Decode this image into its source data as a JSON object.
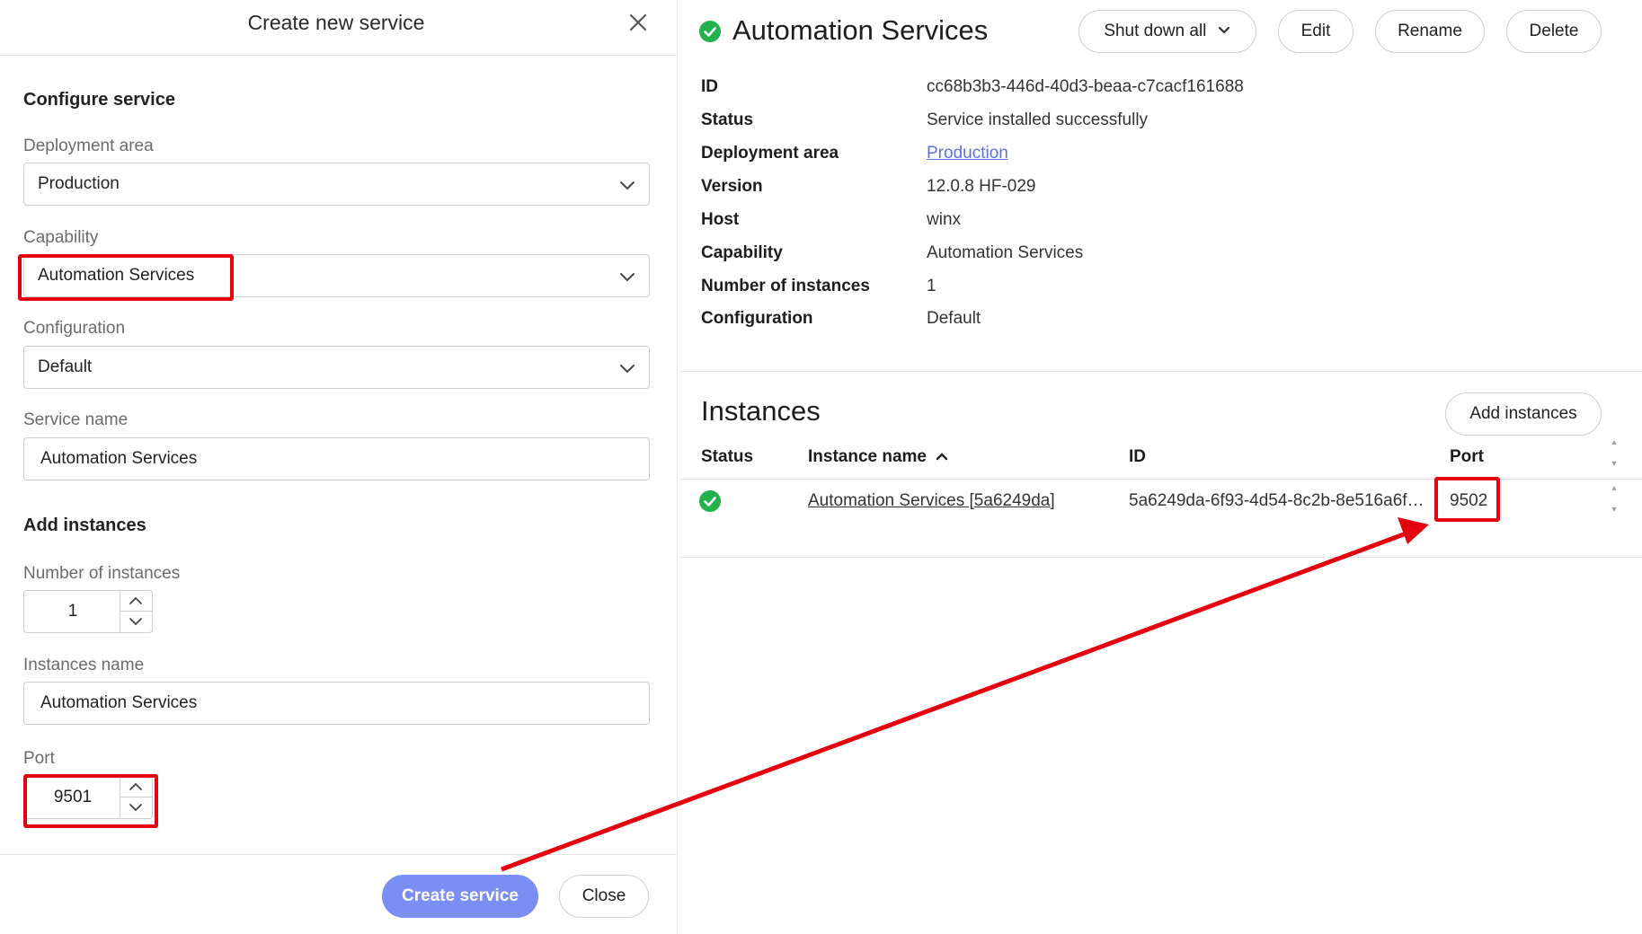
{
  "dialog": {
    "title": "Create new service",
    "configure_title": "Configure service",
    "deployment_area": {
      "label": "Deployment area",
      "value": "Production"
    },
    "capability": {
      "label": "Capability",
      "value": "Automation Services"
    },
    "configuration": {
      "label": "Configuration",
      "value": "Default"
    },
    "service_name": {
      "label": "Service name",
      "value": "Automation Services"
    },
    "add_instances_title": "Add instances",
    "number_of_instances": {
      "label": "Number of instances",
      "value": "1"
    },
    "instances_name": {
      "label": "Instances name",
      "value": "Automation Services"
    },
    "port": {
      "label": "Port",
      "value": "9501"
    },
    "create_label": "Create service",
    "close_label": "Close"
  },
  "service": {
    "title": "Automation Services",
    "actions": {
      "shutdown": "Shut down all",
      "edit": "Edit",
      "rename": "Rename",
      "delete": "Delete"
    },
    "details": [
      {
        "key": "ID",
        "value": "cc68b3b3-446d-40d3-beaa-c7cacf161688",
        "link": false
      },
      {
        "key": "Status",
        "value": "Service installed successfully",
        "link": false
      },
      {
        "key": "Deployment area",
        "value": "Production",
        "link": true
      },
      {
        "key": "Version",
        "value": "12.0.8 HF-029",
        "link": false
      },
      {
        "key": "Host",
        "value": "winx",
        "link": false
      },
      {
        "key": "Capability",
        "value": "Automation Services",
        "link": false
      },
      {
        "key": "Number of instances",
        "value": "1",
        "link": false
      },
      {
        "key": "Configuration",
        "value": "Default",
        "link": false
      }
    ]
  },
  "instances": {
    "title": "Instances",
    "add_label": "Add instances",
    "columns": {
      "status": "Status",
      "name": "Instance name",
      "id": "ID",
      "port": "Port"
    },
    "rows": [
      {
        "name": "Automation Services [5a6249da]",
        "id": "5a6249da-6f93-4d54-8c2b-8e516a6f…",
        "port": "9502"
      }
    ]
  },
  "colors": {
    "accent": "#7b8ef3",
    "link": "#5a72e6",
    "success": "#22b14c",
    "highlight": "#e6000f"
  },
  "icons": [
    "close-icon",
    "chevron-down-icon",
    "chevron-up-icon",
    "check-circle-icon",
    "sort-up-icon",
    "arrow-annotation"
  ]
}
